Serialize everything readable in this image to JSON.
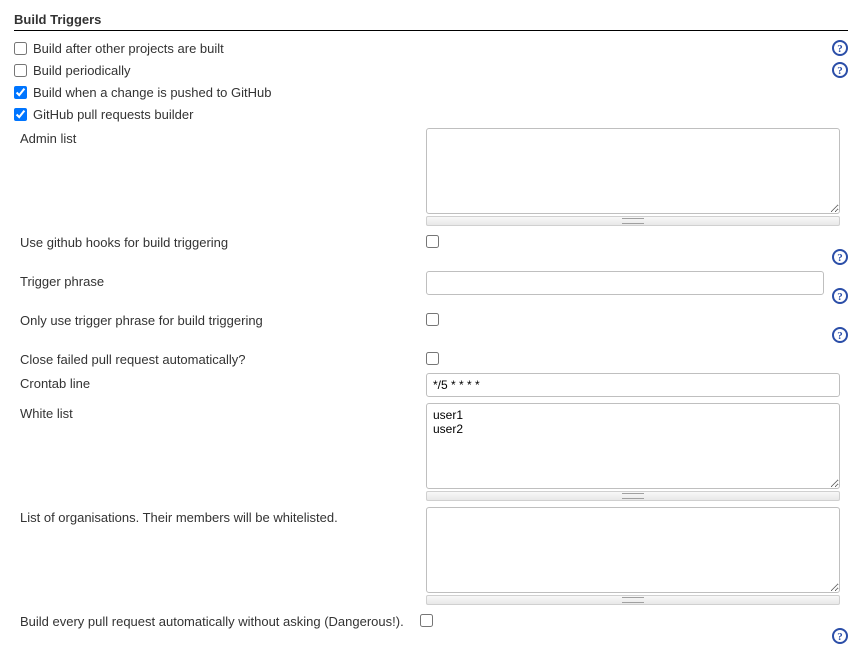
{
  "section": {
    "title": "Build Triggers"
  },
  "triggers": {
    "build_after_other": {
      "label": "Build after other projects are built",
      "checked": false,
      "help": true
    },
    "build_periodically": {
      "label": "Build periodically",
      "checked": false,
      "help": true
    },
    "build_on_github_push": {
      "label": "Build when a change is pushed to GitHub",
      "checked": true,
      "help": false
    },
    "github_pr_builder": {
      "label": "GitHub pull requests builder",
      "checked": true,
      "help": false
    }
  },
  "pr_builder": {
    "admin_list": {
      "label": "Admin list",
      "value": ""
    },
    "use_hooks": {
      "label": "Use github hooks for build triggering",
      "checked": false,
      "help": true
    },
    "trigger_phrase": {
      "label": "Trigger phrase",
      "value": "",
      "help": true
    },
    "only_trigger_phrase": {
      "label": "Only use trigger phrase for build triggering",
      "checked": false,
      "help": true
    },
    "close_failed": {
      "label": "Close failed pull request automatically?",
      "checked": false,
      "help": false
    },
    "crontab": {
      "label": "Crontab line",
      "value": "*/5 * * * *"
    },
    "white_list": {
      "label": "White list",
      "value": "user1\nuser2"
    },
    "orgs_list": {
      "label": "List of organisations. Their members will be whitelisted.",
      "value": ""
    },
    "build_every_pr": {
      "label": "Build every pull request automatically without asking (Dangerous!).",
      "checked": false,
      "help": true
    }
  }
}
